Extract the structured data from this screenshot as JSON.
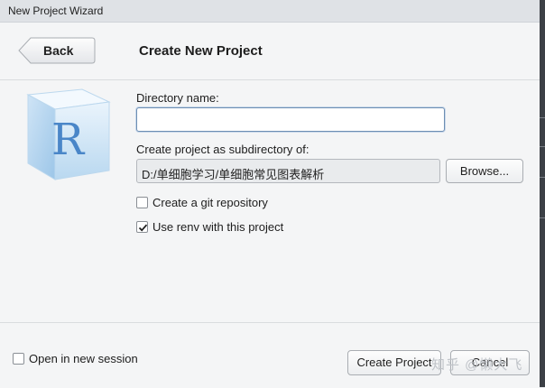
{
  "window": {
    "title": "New Project Wizard"
  },
  "header": {
    "back_label": "Back",
    "page_title": "Create New Project"
  },
  "logo": {
    "letter": "R"
  },
  "form": {
    "directory_name_label": "Directory name:",
    "directory_name_value": "",
    "subdirectory_label": "Create project as subdirectory of:",
    "subdirectory_path": "D:/单细胞学习/单细胞常见图表解析",
    "browse_label": "Browse...",
    "git_label": "Create a git repository",
    "git_checked": false,
    "renv_label": "Use renv with this project",
    "renv_checked": true
  },
  "footer": {
    "open_new_session_label": "Open in new session",
    "open_new_session_checked": false,
    "create_label": "Create Project",
    "cancel_label": "Cancel"
  },
  "watermark": {
    "text": "知乎 @懒大飞"
  },
  "colors": {
    "input_focus_border": "#6d8eb3",
    "panel_bg": "#f4f5f6",
    "logo_letter": "#4a86c8"
  }
}
